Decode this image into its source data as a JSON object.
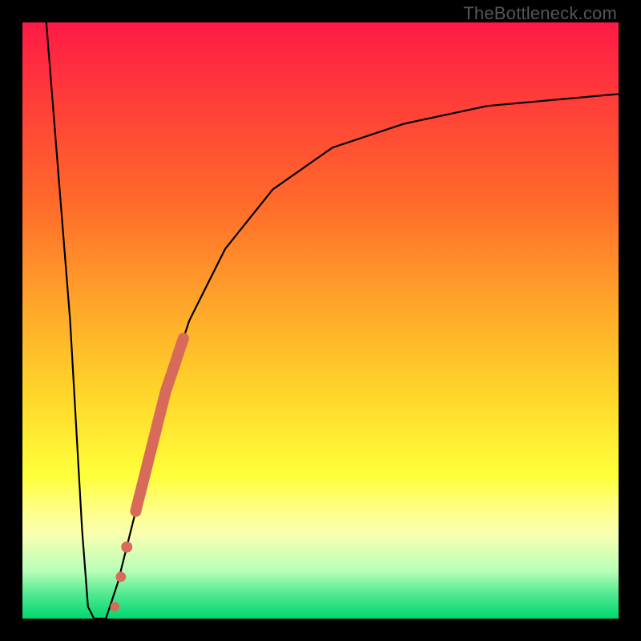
{
  "watermark": "TheBottleneck.com",
  "colors": {
    "frame": "#000000",
    "curve": "#000000",
    "marker": "#d86a5a",
    "gradient_stops": [
      "#ff1a47",
      "#ff3a3a",
      "#ff6a2a",
      "#ffa82a",
      "#ffd82a",
      "#ffff3a",
      "#ffff8a",
      "#f8ffb0",
      "#b8ffb8",
      "#50e890",
      "#00d870"
    ]
  },
  "chart_data": {
    "type": "line",
    "title": "",
    "xlabel": "",
    "ylabel": "",
    "xlim": [
      0,
      100
    ],
    "ylim": [
      0,
      100
    ],
    "grid": false,
    "legend": false,
    "description": "Bottleneck-style V curve: value drops sharply from 100 at x≈4 to 0 at x≈12, then rises along a decelerating curve toward ~88 at x=100.",
    "curve_points": [
      {
        "x": 4,
        "y": 100
      },
      {
        "x": 8,
        "y": 50
      },
      {
        "x": 10,
        "y": 15
      },
      {
        "x": 11,
        "y": 2
      },
      {
        "x": 12,
        "y": 0
      },
      {
        "x": 14,
        "y": 0
      },
      {
        "x": 16,
        "y": 6
      },
      {
        "x": 18,
        "y": 14
      },
      {
        "x": 20,
        "y": 22
      },
      {
        "x": 24,
        "y": 38
      },
      {
        "x": 28,
        "y": 50
      },
      {
        "x": 34,
        "y": 62
      },
      {
        "x": 42,
        "y": 72
      },
      {
        "x": 52,
        "y": 79
      },
      {
        "x": 64,
        "y": 83
      },
      {
        "x": 78,
        "y": 86
      },
      {
        "x": 100,
        "y": 88
      }
    ],
    "highlight_band": {
      "x_start": 19,
      "x_end": 27,
      "note": "thick coral segment along rising leg"
    },
    "highlight_dots": [
      {
        "x": 17.5,
        "y": 12
      },
      {
        "x": 16.5,
        "y": 7
      },
      {
        "x": 15.5,
        "y": 2
      }
    ]
  }
}
